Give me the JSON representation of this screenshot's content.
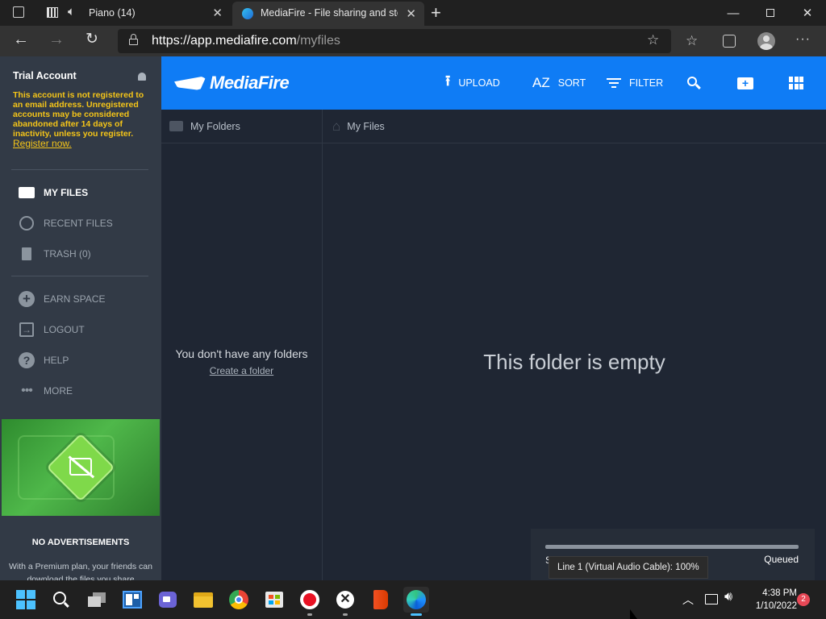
{
  "browser": {
    "tabs": [
      {
        "title": "Piano (14)"
      },
      {
        "title": "MediaFire - File sharing and stor"
      }
    ],
    "url_main": "https://app.mediafire.com",
    "url_path": "/myfiles"
  },
  "sidebar": {
    "account_title": "Trial Account",
    "warning": "This account is not registered to an email address. Unregistered accounts may be considered abandoned after 14 days of inactivity, unless you register.",
    "register_link": "Register now.",
    "nav": [
      {
        "label": "MY FILES"
      },
      {
        "label": "RECENT FILES"
      },
      {
        "label": "TRASH (0)"
      }
    ],
    "extra": [
      {
        "label": "EARN SPACE"
      },
      {
        "label": "LOGOUT"
      },
      {
        "label": "HELP"
      },
      {
        "label": "MORE"
      }
    ],
    "promo_title": "NO ADVERTISEMENTS",
    "promo_text": "With a Premium plan, your friends can download the files you share"
  },
  "header": {
    "logo": "MediaFire",
    "upload": "UPLOAD",
    "sort": "SORT",
    "sort_icon_text": "AZ",
    "filter": "FILTER"
  },
  "folders": {
    "title": "My Folders",
    "empty": "You don't have any folders",
    "create": "Create a folder"
  },
  "files": {
    "title": "My Files",
    "empty": "This folder is empty"
  },
  "upload_status": {
    "partial_label": "S",
    "status": "Queued",
    "tooltip": "Line 1 (Virtual Audio Cable): 100%"
  },
  "taskbar": {
    "time": "4:38 PM",
    "date": "1/10/2022",
    "notifications": "2"
  },
  "colors": {
    "accent": "#0f7cf5",
    "sidebar_bg": "#323a46",
    "warning_text": "#f5c518",
    "content_bg": "#1f2633"
  }
}
